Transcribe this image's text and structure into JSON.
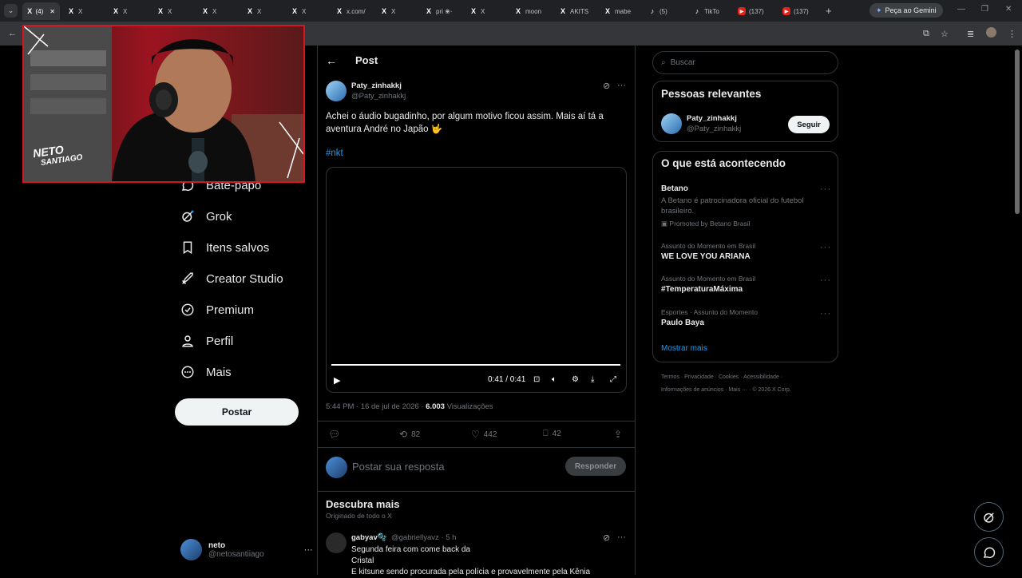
{
  "browser": {
    "tabs": [
      {
        "icon": "X",
        "label": "(4)",
        "active": true
      },
      {
        "icon": "X",
        "label": "X"
      },
      {
        "icon": "X",
        "label": "X"
      },
      {
        "icon": "X",
        "label": "X"
      },
      {
        "icon": "X",
        "label": "X"
      },
      {
        "icon": "X",
        "label": "X"
      },
      {
        "icon": "X",
        "label": "X"
      },
      {
        "icon": "X",
        "label": "x.com/"
      },
      {
        "icon": "X",
        "label": "X"
      },
      {
        "icon": "X",
        "label": "pri ❀·"
      },
      {
        "icon": "X",
        "label": "X"
      },
      {
        "icon": "X",
        "label": "moon"
      },
      {
        "icon": "X",
        "label": "AKITS"
      },
      {
        "icon": "X",
        "label": "mabe"
      },
      {
        "icon": "♪",
        "label": "(5)"
      },
      {
        "icon": "♪",
        "label": "TikTo"
      },
      {
        "icon": "yt",
        "label": "(137)"
      },
      {
        "icon": "yt",
        "label": "(137)"
      }
    ],
    "new_tab": "+",
    "gemini_label": "Peça ao Gemini"
  },
  "nav": {
    "items": [
      {
        "label": "Bate-papo",
        "icon": "chat-icon"
      },
      {
        "label": "Grok",
        "icon": "grok-icon"
      },
      {
        "label": "Itens salvos",
        "icon": "bookmark-icon"
      },
      {
        "label": "Creator Studio",
        "icon": "rocket-icon"
      },
      {
        "label": "Premium",
        "icon": "premium-icon"
      },
      {
        "label": "Perfil",
        "icon": "person-icon"
      },
      {
        "label": "Mais",
        "icon": "more-circle-icon"
      }
    ],
    "post_button": "Postar",
    "account": {
      "name": "neto",
      "handle": "@netosantiiago"
    }
  },
  "header": {
    "title": "Post"
  },
  "tweet": {
    "author_name": "Paty_zinhakkj",
    "author_handle": "@Paty_zinhakkj",
    "text_line1": "Achei o áudio bugadinho, por algum motivo ficou assim. Mais aí tá a",
    "text_line2": "aventura André no Japão 🤟",
    "hashtag": "#nkt",
    "video_time": "0:41 / 0:41",
    "video_progress": 1.0,
    "timestamp": "5:44 PM · 16 de jul de 2026 · ",
    "views_count": "6.003",
    "views_label": " Visualizações",
    "retweets": "82",
    "likes": "442",
    "bookmarks": "42"
  },
  "reply": {
    "placeholder": "Postar sua resposta",
    "button": "Responder"
  },
  "discover": {
    "title": "Descubra mais",
    "subtitle": "Originado de todo o X",
    "post": {
      "name": "gabyav🫧",
      "handle": "@gabriellyavz · 5 h",
      "line1": "Segunda feira com come back da",
      "line2": "Cristal",
      "line3": "E kitsune sendo procurada pela polícia e provavelmente pela Kênia"
    }
  },
  "sidebar": {
    "search_placeholder": "Buscar",
    "relevant_title": "Pessoas relevantes",
    "relevant_name": "Paty_zinhakkj",
    "relevant_handle": "@Paty_zinhakkj",
    "follow_label": "Seguir",
    "trends_title": "O que está acontecendo",
    "promo_name": "Betano",
    "promo_text_line1": "A Betano é patrocinadora oficial do futebol",
    "promo_text_line2": "brasileiro.",
    "promo_label": "Promoted by Betano Brasil",
    "trends": [
      {
        "category": "Assunto do Momento em Brasil",
        "name": "WE LOVE YOU ARIANA"
      },
      {
        "category": "Assunto do Momento em Brasil",
        "name": "#TemperaturaMáxima"
      },
      {
        "category": "Esportes · Assunto do Momento",
        "name": "Paulo Baya"
      }
    ],
    "show_more": "Mostrar mais",
    "footer_line1": "Termos · Privacidade · Cookies · Acessibilidade ·",
    "footer_line2": "Informações de anúncios · Mais ··· · © 2026 X Corp."
  },
  "webcam": {
    "overlay_text_line1": "NETO",
    "overlay_text_line2": "SANTIAGO"
  }
}
